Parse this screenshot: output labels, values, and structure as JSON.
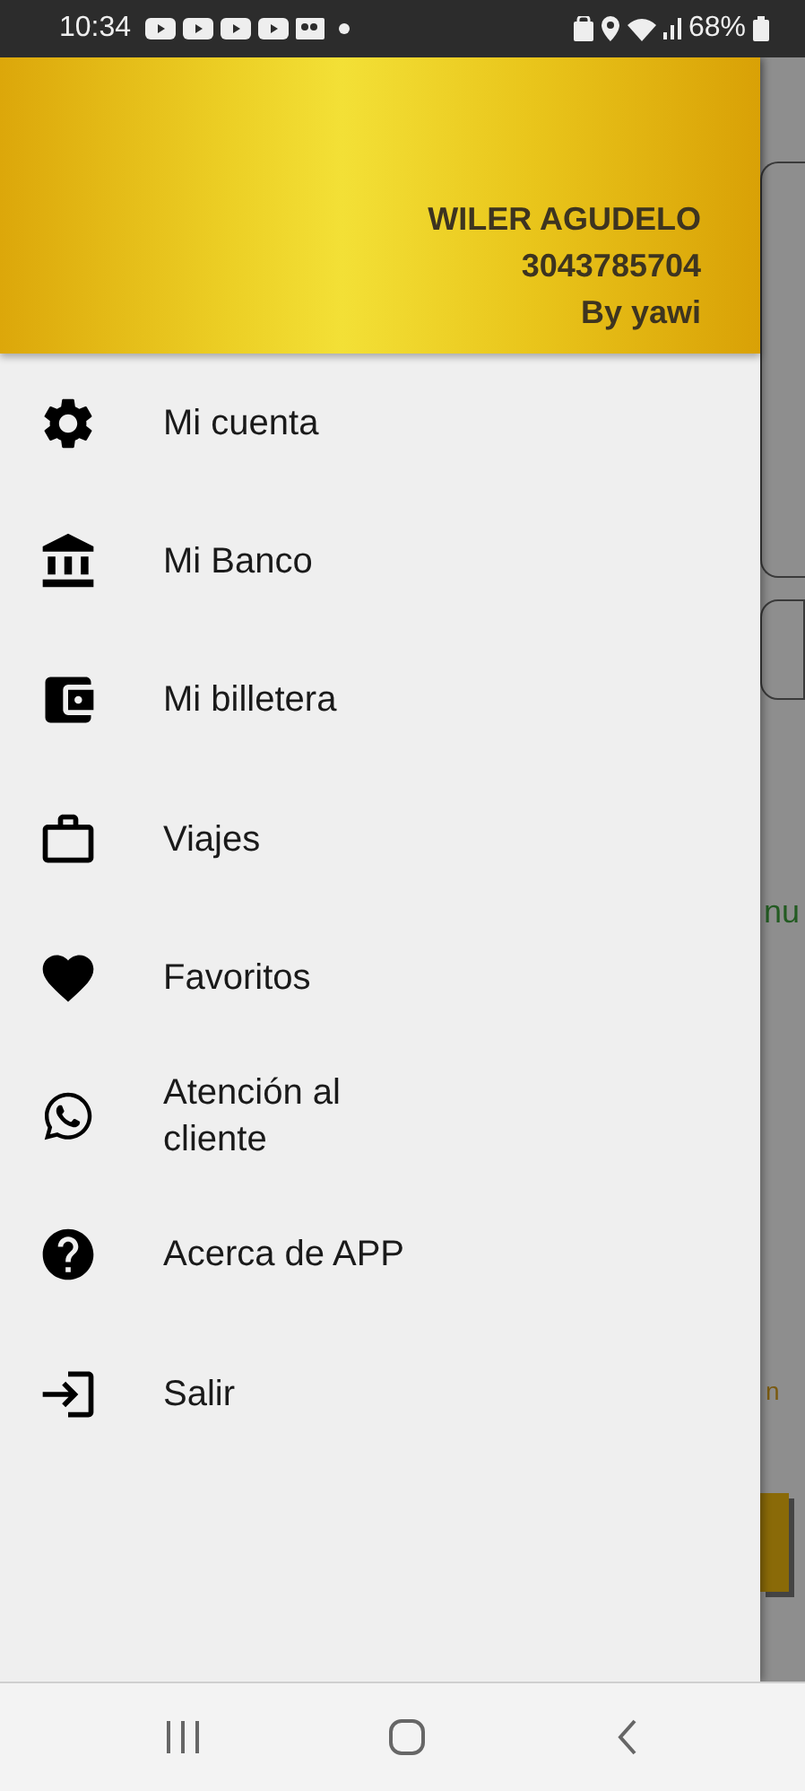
{
  "status_bar": {
    "time": "10:34",
    "battery": "68%"
  },
  "header": {
    "name": "WILER AGUDELO",
    "phone": "3043785704",
    "byline": "By yawi"
  },
  "menu": [
    {
      "label": "Mi cuenta",
      "kind": "settings"
    },
    {
      "label": "Mi Banco",
      "kind": "bank"
    },
    {
      "label": "Mi billetera",
      "kind": "wallet"
    },
    {
      "label": "Viajes",
      "kind": "briefcase"
    },
    {
      "label": "Favoritos",
      "kind": "heart"
    },
    {
      "label": "Atención al cliente",
      "kind": "whatsapp"
    },
    {
      "label": "Acerca de APP",
      "kind": "help"
    },
    {
      "label": "Salir",
      "kind": "exit"
    }
  ],
  "background_texts": [
    "nu",
    "n"
  ]
}
